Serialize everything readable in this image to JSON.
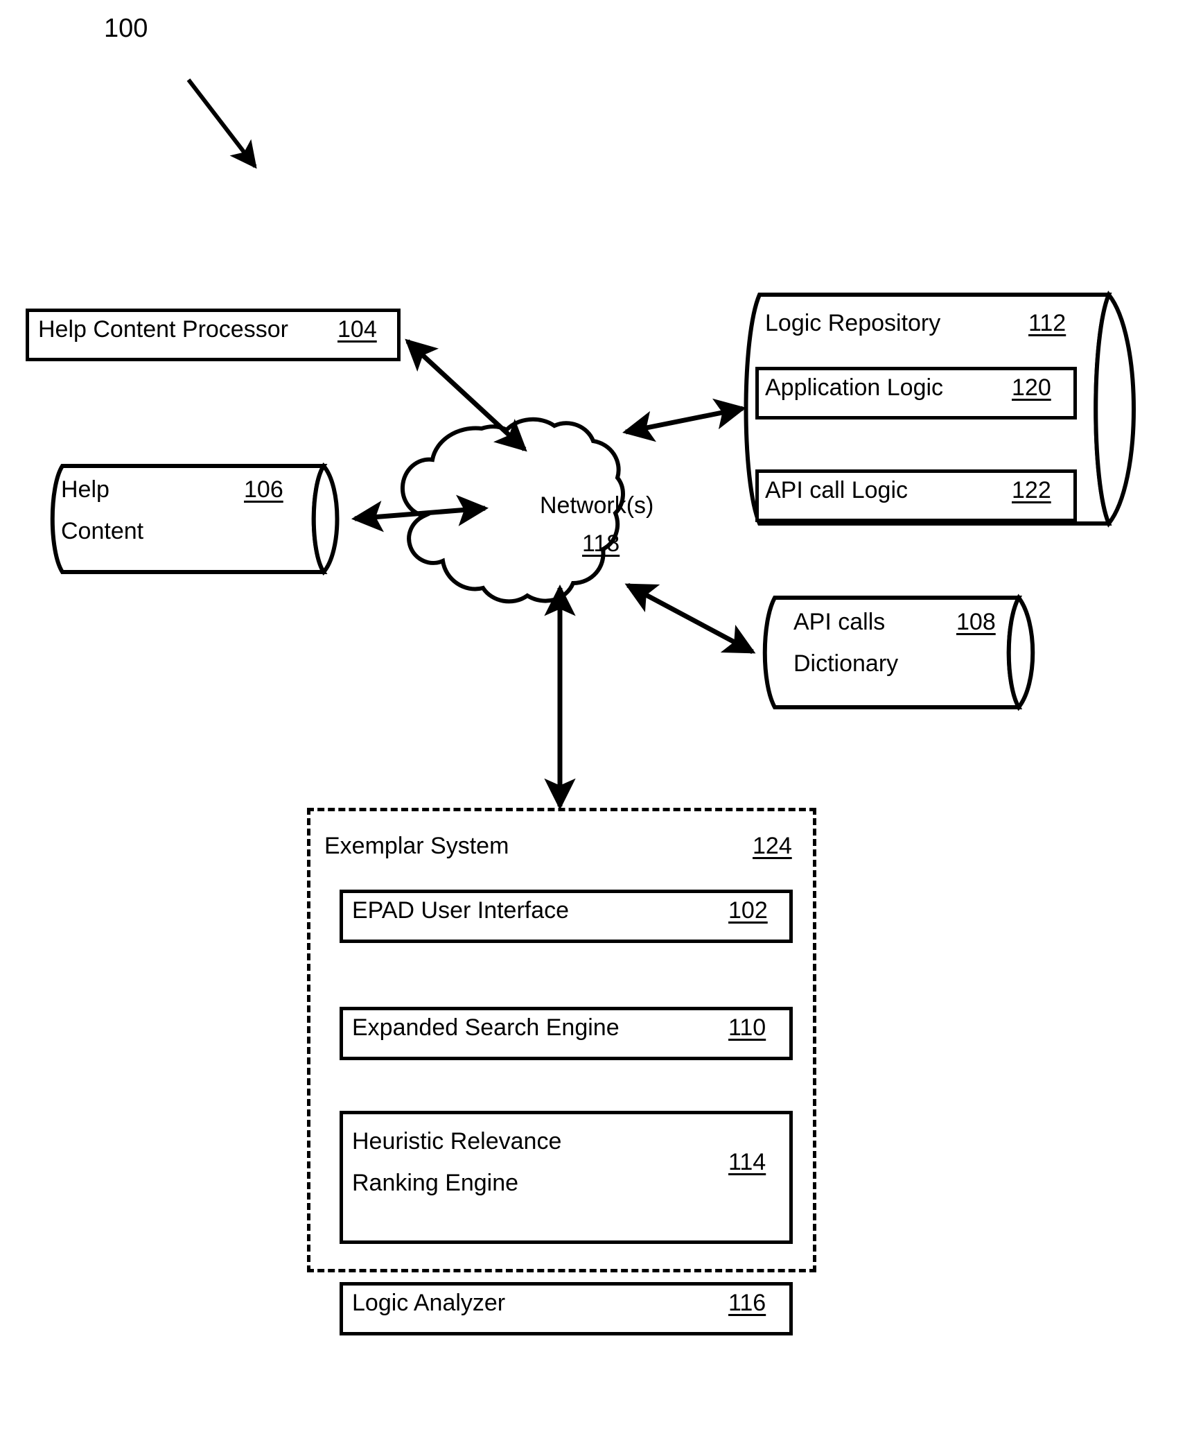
{
  "figure": {
    "number": "100",
    "type": "patent-system-diagram"
  },
  "nodes": {
    "help_content_processor": {
      "label": "Help Content Processor",
      "ref": "104",
      "shape": "rectangle"
    },
    "help_content": {
      "label_line1": "Help",
      "label_line2": "Content",
      "ref": "106",
      "shape": "cylinder"
    },
    "network": {
      "label": "Network(s)",
      "ref": "118",
      "shape": "cloud"
    },
    "logic_repository": {
      "label": "Logic Repository",
      "ref": "112",
      "shape": "cylinder"
    },
    "application_logic": {
      "label": "Application Logic",
      "ref": "120",
      "shape": "rectangle"
    },
    "api_call_logic": {
      "label": "API call Logic",
      "ref": "122",
      "shape": "rectangle"
    },
    "api_calls_dictionary": {
      "label_line1": "API calls",
      "label_line2": "Dictionary",
      "ref": "108",
      "shape": "cylinder"
    },
    "exemplar_system": {
      "label": "Exemplar System",
      "ref": "124",
      "shape": "dashed-rectangle"
    },
    "epad_user_interface": {
      "label": "EPAD User Interface",
      "ref": "102",
      "shape": "rectangle"
    },
    "expanded_search_engine": {
      "label": "Expanded Search Engine",
      "ref": "110",
      "shape": "rectangle"
    },
    "heuristic_ranking": {
      "label_line1": "Heuristic Relevance",
      "label_line2": "Ranking Engine",
      "ref": "114",
      "shape": "rectangle"
    },
    "logic_analyzer": {
      "label": "Logic Analyzer",
      "ref": "116",
      "shape": "rectangle"
    }
  },
  "connections": [
    {
      "from": "network",
      "to": "help_content_processor",
      "style": "double-arrow"
    },
    {
      "from": "network",
      "to": "help_content",
      "style": "double-arrow"
    },
    {
      "from": "network",
      "to": "logic_repository",
      "style": "double-arrow"
    },
    {
      "from": "network",
      "to": "api_calls_dictionary",
      "style": "double-arrow"
    },
    {
      "from": "network",
      "to": "exemplar_system",
      "style": "double-arrow"
    }
  ],
  "colors": {
    "line": "#000000",
    "background": "#ffffff"
  }
}
